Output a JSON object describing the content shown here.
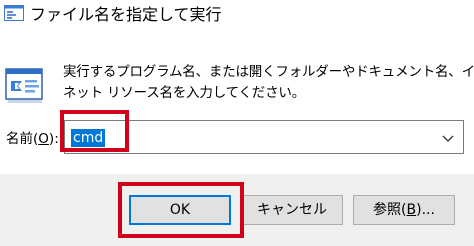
{
  "window": {
    "title": "ファイル名を指定して実行"
  },
  "description": {
    "line1": "実行するプログラム名、または開くフォルダーやドキュメント名、インター",
    "line2": "ネット リソース名を入力してください。"
  },
  "open_field": {
    "label": "名前",
    "label_open_paren": "(",
    "accelerator": "O",
    "label_close": "):",
    "value": "cmd"
  },
  "buttons": {
    "ok": "OK",
    "cancel": "キャンセル",
    "browse_label": "参照(",
    "browse_accelerator": "B",
    "browse_suffix": ")..."
  },
  "colors": {
    "highlight_box": "#d0021b",
    "selection": "#0078d7",
    "footer_bg": "#f0f0f0"
  },
  "icons": {
    "title": "run-dialog-icon",
    "body": "run-program-icon",
    "dropdown": "chevron-down-icon"
  }
}
